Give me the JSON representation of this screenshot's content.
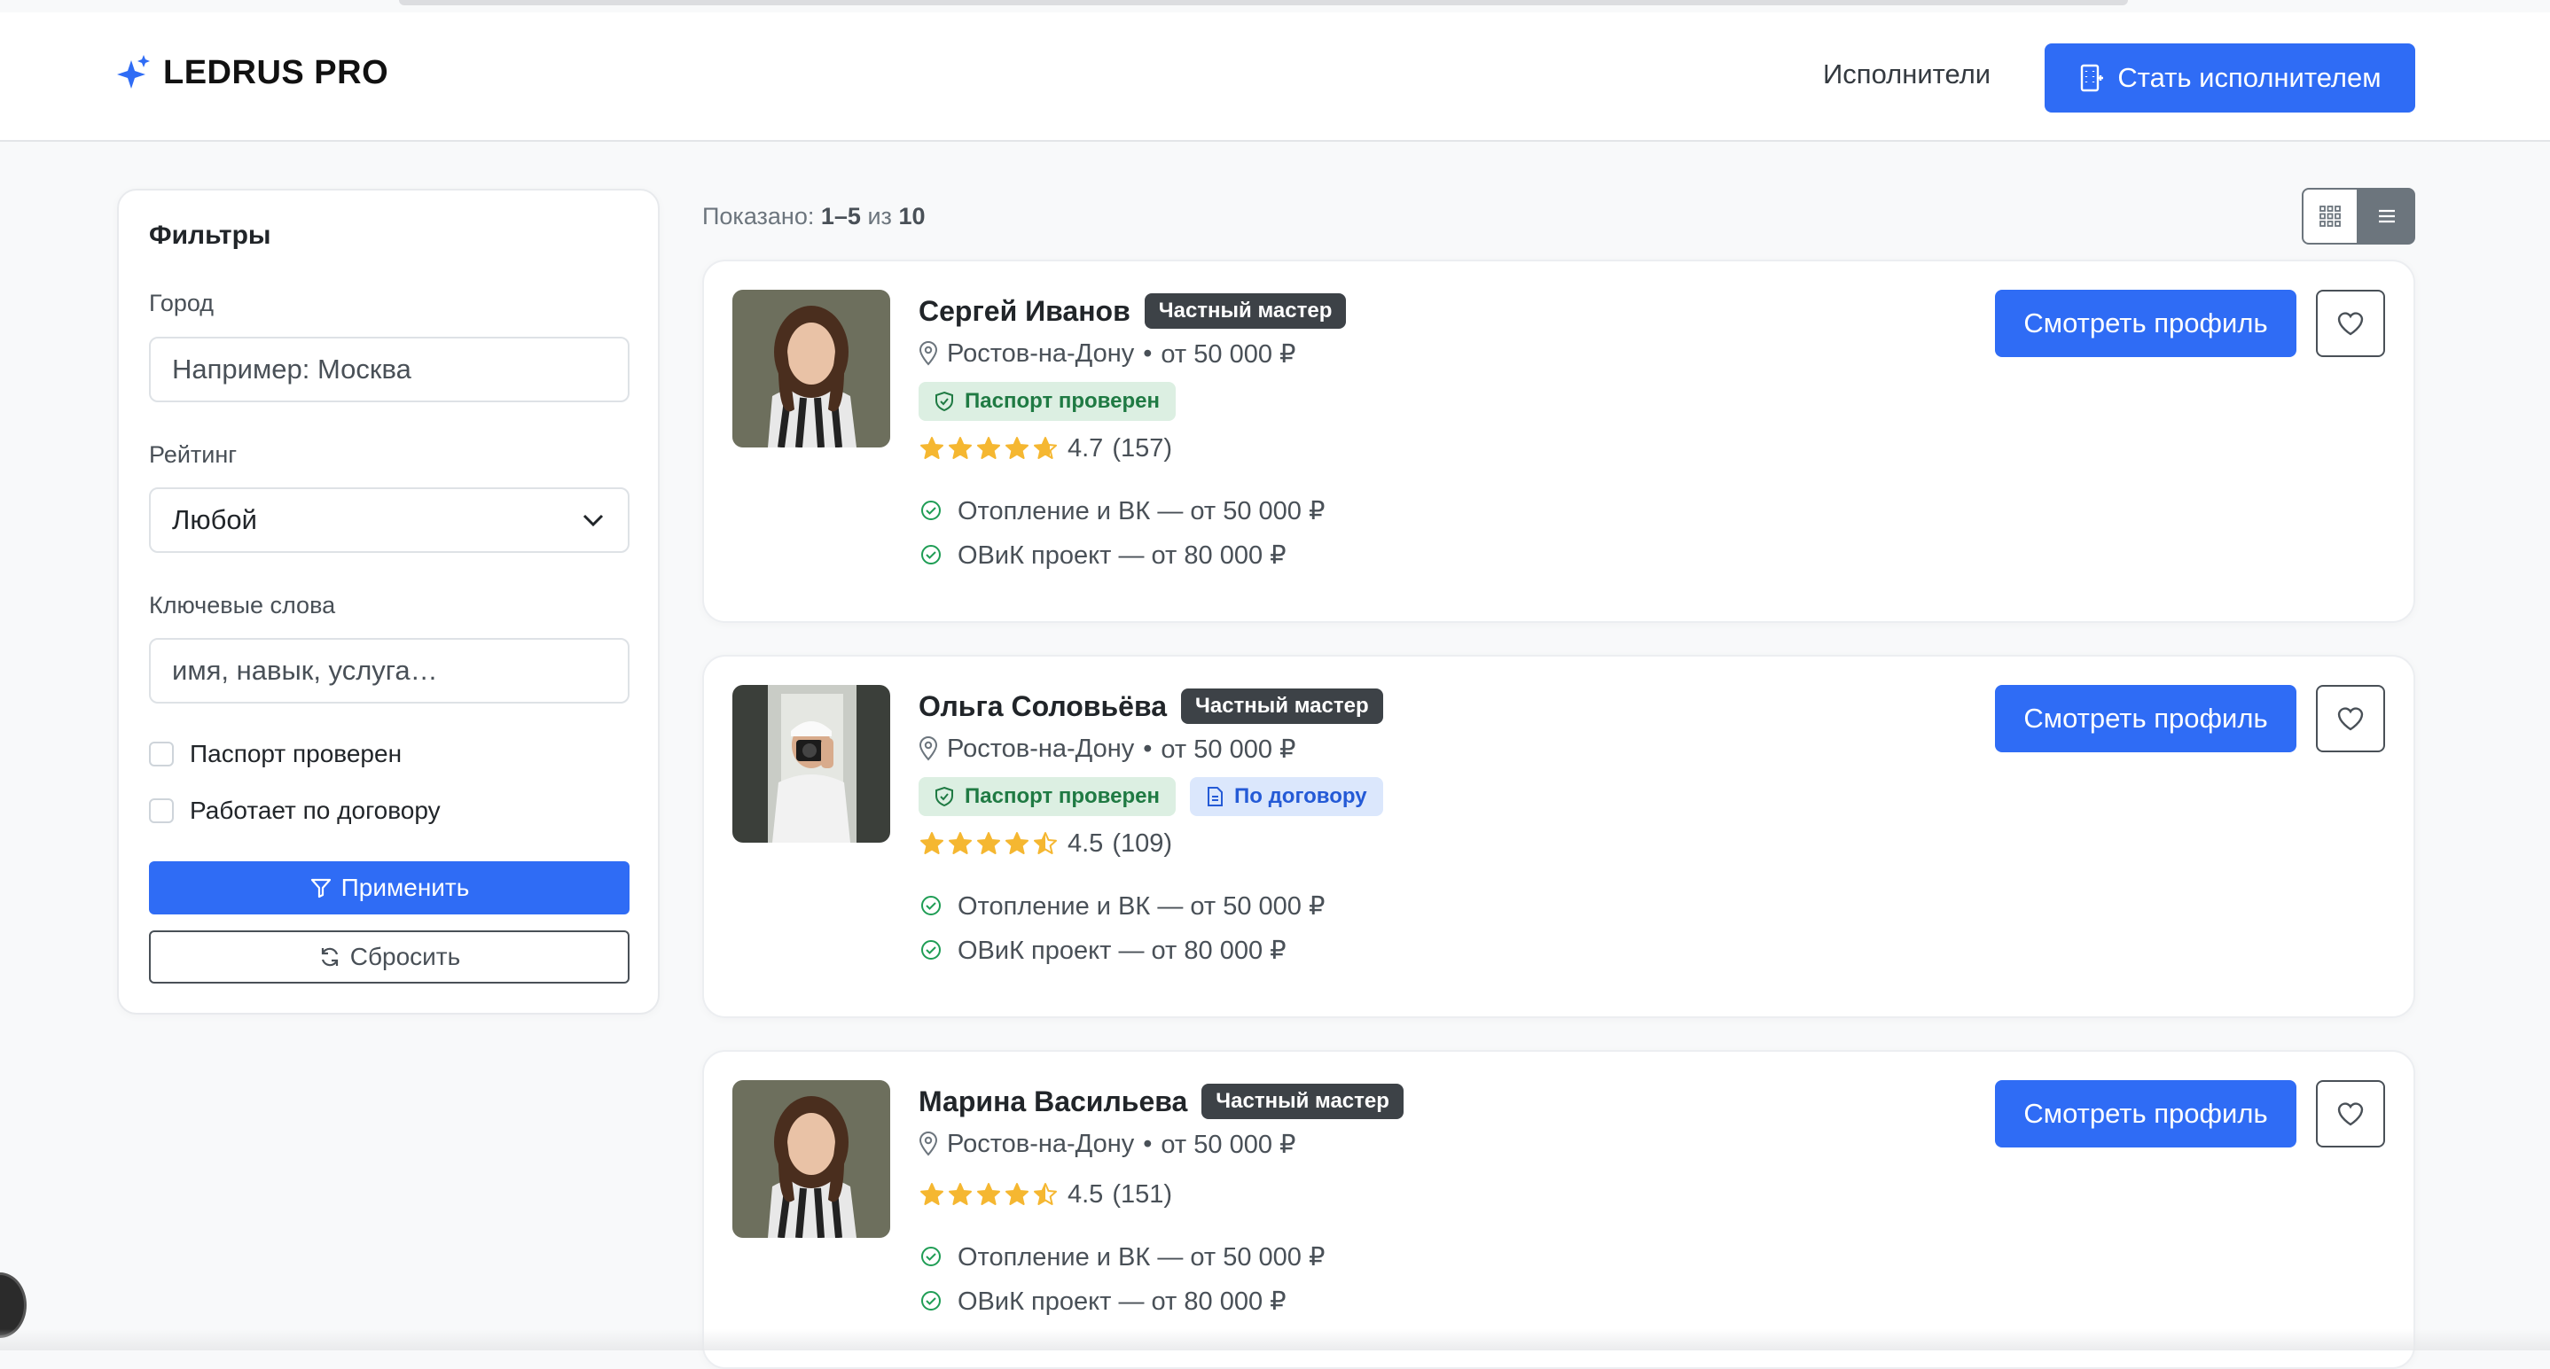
{
  "brand": {
    "name": "LEDRUS PRO"
  },
  "nav": {
    "link": "Исполнители",
    "cta": "Стать исполнителем"
  },
  "filters": {
    "title": "Фильтры",
    "city_label": "Город",
    "city_placeholder": "Например: Москва",
    "rating_label": "Рейтинг",
    "rating_value": "Любой",
    "keywords_label": "Ключевые слова",
    "keywords_placeholder": "имя, навык, услуга…",
    "check_passport": "Паспорт проверен",
    "check_contract": "Работает по договору",
    "apply": "Применить",
    "reset": "Сбросить"
  },
  "results": {
    "shown_label": "Показано:",
    "shown_range": "1–5",
    "of": "из",
    "total": "10"
  },
  "colors": {
    "primary": "#2f6cf5",
    "star": "#f5b731",
    "verified_bg": "#dcefe2",
    "contract_bg": "#dbe7fc"
  },
  "cards": [
    {
      "name": "Сергей Иванов",
      "type": "Частный мастер",
      "city": "Ростов-на-Дону",
      "price": "от 50 000 ₽",
      "badge_passport": "Паспорт проверен",
      "rating": "4.7",
      "reviews": "(157)",
      "stars": 4.7,
      "services": [
        "Отопление и ВК — от 50 000 ₽",
        "ОВиК проект — от 80 000 ₽"
      ],
      "profile_btn": "Смотреть профиль"
    },
    {
      "name": "Ольга Соловьёва",
      "type": "Частный мастер",
      "city": "Ростов-на-Дону",
      "price": "от 50 000 ₽",
      "badge_passport": "Паспорт проверен",
      "badge_contract": "По договору",
      "rating": "4.5",
      "reviews": "(109)",
      "stars": 4.5,
      "services": [
        "Отопление и ВК — от 50 000 ₽",
        "ОВиК проект — от 80 000 ₽"
      ],
      "profile_btn": "Смотреть профиль"
    },
    {
      "name": "Марина Васильева",
      "type": "Частный мастер",
      "city": "Ростов-на-Дону",
      "price": "от 50 000 ₽",
      "rating": "4.5",
      "reviews": "(151)",
      "stars": 4.5,
      "services": [
        "Отопление и ВК — от 50 000 ₽",
        "ОВиК проект — от 80 000 ₽"
      ],
      "profile_btn": "Смотреть профиль"
    }
  ]
}
